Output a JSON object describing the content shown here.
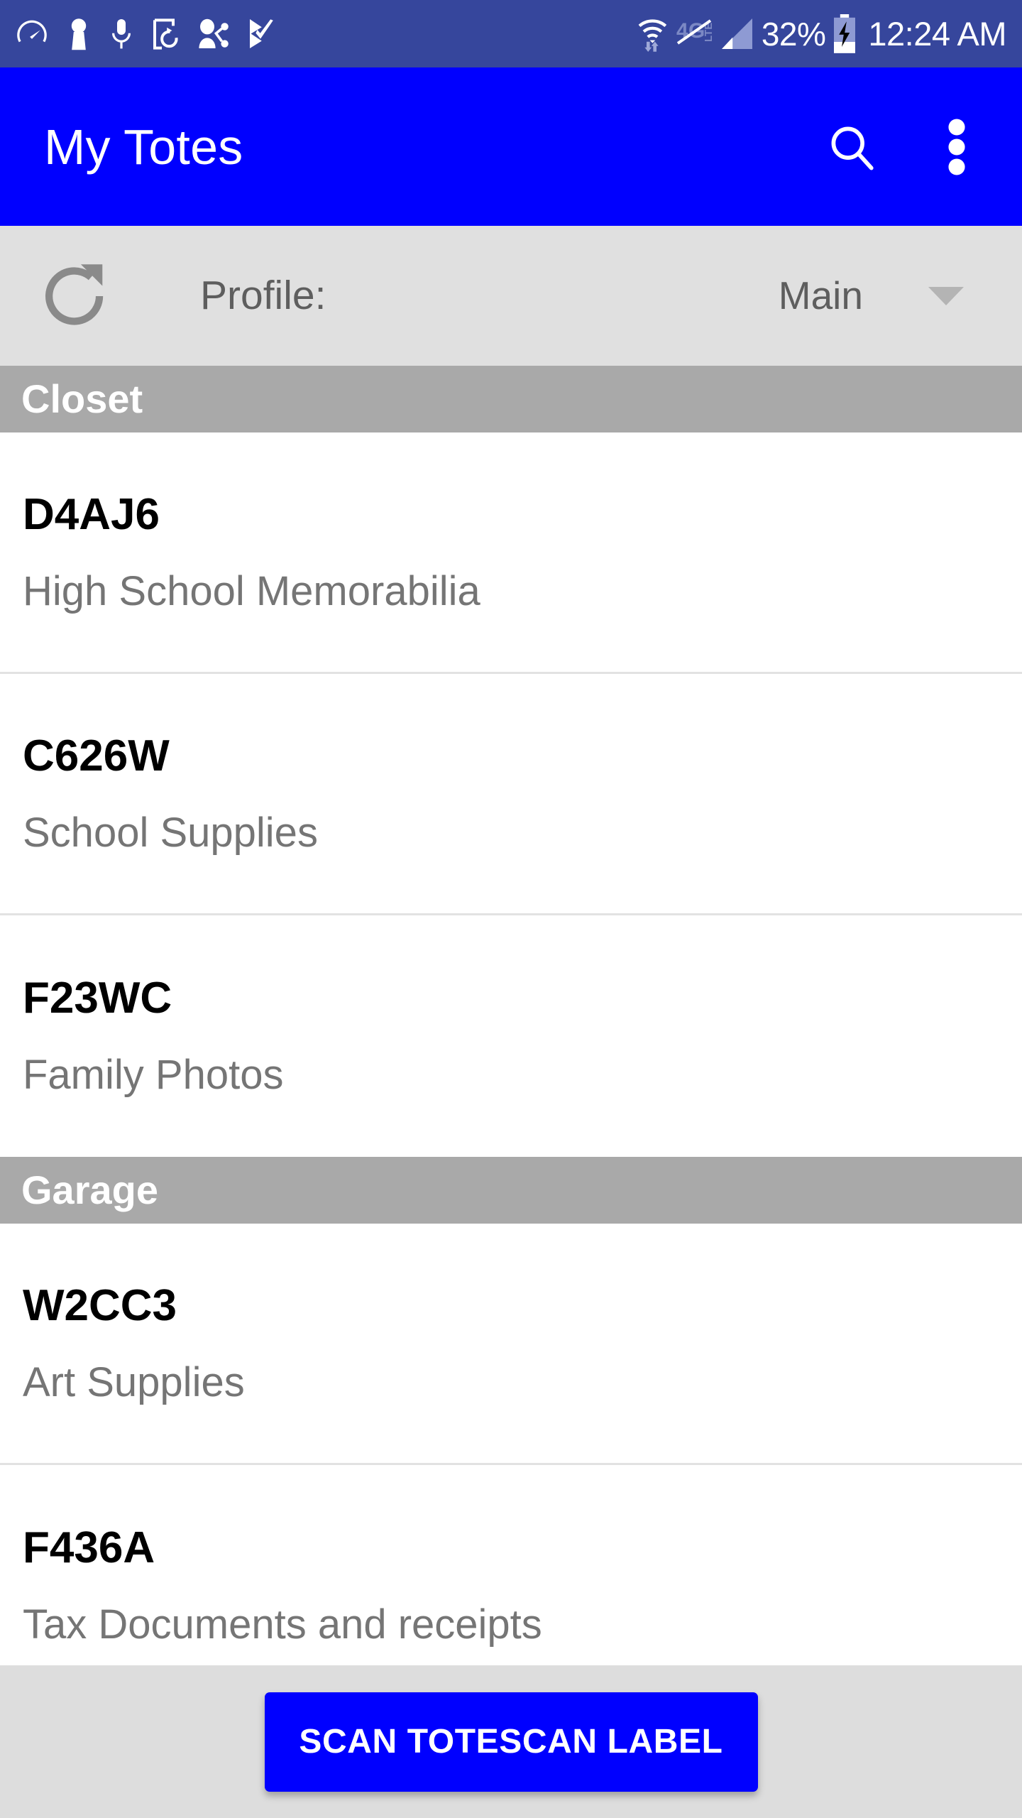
{
  "status_bar": {
    "background_color": "#36469C",
    "left_icons": [
      "speedometer-icon",
      "person-keyhole-icon",
      "microphone-icon",
      "screen-rotation-icon",
      "person-share-icon",
      "checkmark-flag-icon"
    ],
    "right_icons": [
      "wifi-transfer-icon",
      "lte-disabled-icon",
      "cellular-signal-icon",
      "battery-charging-icon"
    ],
    "battery_percent": "32%",
    "time": "12:24 AM"
  },
  "app_bar": {
    "title": "My Totes",
    "background_color": "#0000FF",
    "search_icon": "search-icon",
    "overflow_icon": "more-vertical-icon"
  },
  "profile_row": {
    "refresh_icon": "refresh-icon",
    "label": "Profile:",
    "value": "Main",
    "caret_icon": "chevron-down-icon",
    "background_color": "#E0E0E0"
  },
  "sections": [
    {
      "header": "Closet",
      "items": [
        {
          "code": "D4AJ6",
          "description": "High School Memorabilia"
        },
        {
          "code": "C626W",
          "description": "School Supplies"
        },
        {
          "code": "F23WC",
          "description": "Family Photos"
        }
      ]
    },
    {
      "header": "Garage",
      "items": [
        {
          "code": "W2CC3",
          "description": "Art Supplies"
        },
        {
          "code": "F436A",
          "description": "Tax Documents and receipts"
        }
      ]
    }
  ],
  "bottom_bar": {
    "scan_button_label": "SCAN TOTESCAN LABEL",
    "button_color": "#0000FF",
    "background_color": "#DDDDDD"
  }
}
